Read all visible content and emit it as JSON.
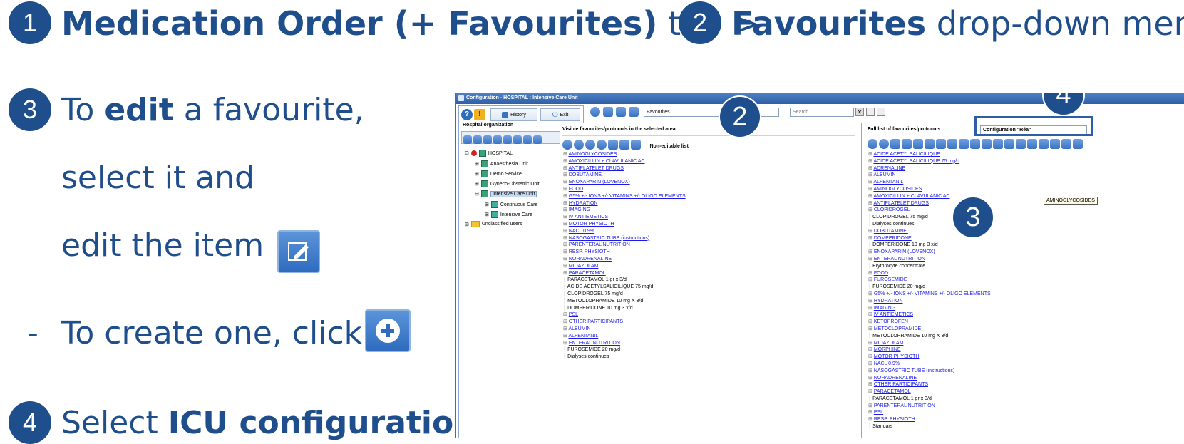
{
  "header": {
    "badge1": "1",
    "part1_bold": "Medication Order (+ Favourites)",
    "part1_rest": " tab >",
    "badge2": "2",
    "part2_bold": "Favourites",
    "part2_rest": " drop-down menu"
  },
  "instructions": {
    "badge3": "3",
    "line1_pre": "To ",
    "line1_bold": "edit",
    "line1_post": " a favourite,",
    "line2": "select it and",
    "line3": "edit the item",
    "line4_dash": "-",
    "line4": "To create one, click",
    "badge4": "4",
    "line5_pre": "Select ",
    "line5_bold": "ICU configuration"
  },
  "app": {
    "title": "Configuration - HOSPITAL : Intensive Care Unit",
    "left": {
      "history_label": "History",
      "exit_label": "Exit",
      "section_title": "Hospital organization",
      "tree": [
        {
          "label": "HOSPITAL",
          "level": 0
        },
        {
          "label": "Anaesthesia Unit",
          "level": 1
        },
        {
          "label": "Demo Service",
          "level": 1
        },
        {
          "label": "Gyneco-Obstetric Unit",
          "level": 1
        },
        {
          "label": "Intensive Care Unit",
          "level": 1,
          "selected": true
        },
        {
          "label": "Continuous Care",
          "level": 2
        },
        {
          "label": "Intensive Care",
          "level": 2
        },
        {
          "label": "Unclassified users",
          "level": 0
        }
      ]
    },
    "top": {
      "favourites_value": "Favourites",
      "search_placeholder": "Search"
    },
    "middle": {
      "title": "Visible favourites/protocols in the selected area",
      "non_editable": "Non-editable list",
      "items": [
        {
          "t": "AMINOGLYCOSIDES",
          "k": "l"
        },
        {
          "t": "AMOXICILLIN + CLAVULANIC AC",
          "k": "l"
        },
        {
          "t": "ANTIPLATELET DRUGS",
          "k": "l"
        },
        {
          "t": "DOBUTAMINE.",
          "k": "l"
        },
        {
          "t": "ENOXAPARIN (LOVENOX)",
          "k": "l"
        },
        {
          "t": "FOOD",
          "k": "l"
        },
        {
          "t": "G5% +/- IONS +/- VITAMINS +/- OLIGO ELEMENTS",
          "k": "l"
        },
        {
          "t": "HYDRATION",
          "k": "l"
        },
        {
          "t": "IMAGING",
          "k": "l"
        },
        {
          "t": "IV ANTIEMETICS",
          "k": "l"
        },
        {
          "t": "MOTOR PHYSIOTH",
          "k": "l"
        },
        {
          "t": "NACL 0.9%",
          "k": "l"
        },
        {
          "t": "NASOGASTRIC TUBE (instructions)",
          "k": "l"
        },
        {
          "t": "PARENTERAL NUTRITION",
          "k": "l"
        },
        {
          "t": "RESP. PHYSIOTH",
          "k": "l"
        },
        {
          "t": "NORADRENALINE",
          "k": "l"
        },
        {
          "t": "MIDAZOLAM",
          "k": "l"
        },
        {
          "t": "PARACETAMOL",
          "k": "l"
        },
        {
          "t": "PARACETAMOL  1 gr x 3/d",
          "k": "p"
        },
        {
          "t": "ACIDE ACETYLSALICILIQUE 75 mg/d",
          "k": "p"
        },
        {
          "t": "CLOPIDROGEL 75 mg/d",
          "k": "p"
        },
        {
          "t": "METOCLOPRAMIDE 10 mg X 3/d",
          "k": "p"
        },
        {
          "t": "DOMPERIDONE 10 mg 3 x/d",
          "k": "p"
        },
        {
          "t": "PSL",
          "k": "l"
        },
        {
          "t": "OTHER PARTICIPANTS",
          "k": "l"
        },
        {
          "t": "ALBUMIN",
          "k": "l"
        },
        {
          "t": "ALFENTANIL",
          "k": "l"
        },
        {
          "t": "ENTERAL NUTRITION",
          "k": "l"
        },
        {
          "t": "FUROSEMIDE 20 mg/d",
          "k": "p"
        },
        {
          "t": "Dialyses continues",
          "k": "p"
        }
      ]
    },
    "right": {
      "title": "Full list of favourites/protocols",
      "config_value": "Configuration \"Réa\"",
      "tooltip": "AMINOGLYCOSIDES",
      "items": [
        {
          "t": "ACIDE ACETYLSALICILIQUE",
          "k": "l"
        },
        {
          "t": "ACIDE ACETYLSALICILIQUE 75 mg/d",
          "k": "l"
        },
        {
          "t": "ADRENALINE",
          "k": "l"
        },
        {
          "t": "ALBUMIN",
          "k": "l"
        },
        {
          "t": "ALFENTANIL",
          "k": "l"
        },
        {
          "t": "AMINOGLYCOSIDES",
          "k": "l"
        },
        {
          "t": "AMOXICILLIN + CLAVULANIC AC",
          "k": "l"
        },
        {
          "t": "ANTIPLATELET DRUGS",
          "k": "l"
        },
        {
          "t": "CLOPIDROGEL",
          "k": "l"
        },
        {
          "t": "CLOPIDROGEL 75 mg/d",
          "k": "p"
        },
        {
          "t": "Dialyses continues",
          "k": "p"
        },
        {
          "t": "DOBUTAMINE.",
          "k": "l"
        },
        {
          "t": "DOMPERIDONE",
          "k": "l"
        },
        {
          "t": "DOMPERIDONE 10 mg 3 x/d",
          "k": "p"
        },
        {
          "t": "ENOXAPARIN (LOVENOX)",
          "k": "l"
        },
        {
          "t": "ENTERAL NUTRITION",
          "k": "l"
        },
        {
          "t": "Erythrocyte concentrate",
          "k": "p"
        },
        {
          "t": "FOOD",
          "k": "l"
        },
        {
          "t": "FUROSEMIDE",
          "k": "l"
        },
        {
          "t": "FUROSEMIDE 20 mg/d",
          "k": "p"
        },
        {
          "t": "G5% +/- IONS +/- VITAMINS +/- OLIGO ELEMENTS",
          "k": "l"
        },
        {
          "t": "HYDRATION",
          "k": "l"
        },
        {
          "t": "IMAGING",
          "k": "l"
        },
        {
          "t": "IV ANTIEMETICS",
          "k": "l"
        },
        {
          "t": "KETOPROFEN",
          "k": "l"
        },
        {
          "t": "METOCLOPRAMIDE",
          "k": "l"
        },
        {
          "t": "METOCLOPRAMIDE 10 mg X 3/d",
          "k": "p"
        },
        {
          "t": "MIDAZOLAM",
          "k": "l"
        },
        {
          "t": "MORPHINE",
          "k": "l"
        },
        {
          "t": "MOTOR PHYSIOTH",
          "k": "l"
        },
        {
          "t": "NACL 0.9%",
          "k": "l"
        },
        {
          "t": "NASOGASTRIC TUBE (instructions)",
          "k": "l"
        },
        {
          "t": "NORADRENALINE",
          "k": "l"
        },
        {
          "t": "OTHER PARTICIPANTS",
          "k": "l"
        },
        {
          "t": "PARACETAMOL",
          "k": "l"
        },
        {
          "t": "PARACETAMOL  1 gr x 3/d",
          "k": "p"
        },
        {
          "t": "PARENTERAL NUTRITION",
          "k": "l"
        },
        {
          "t": "PSL",
          "k": "l"
        },
        {
          "t": "RESP. PHYSIOTH",
          "k": "l"
        },
        {
          "t": "Standars",
          "k": "p"
        }
      ]
    },
    "annotations": {
      "a2": "2",
      "a3": "3",
      "a4": "4"
    }
  }
}
